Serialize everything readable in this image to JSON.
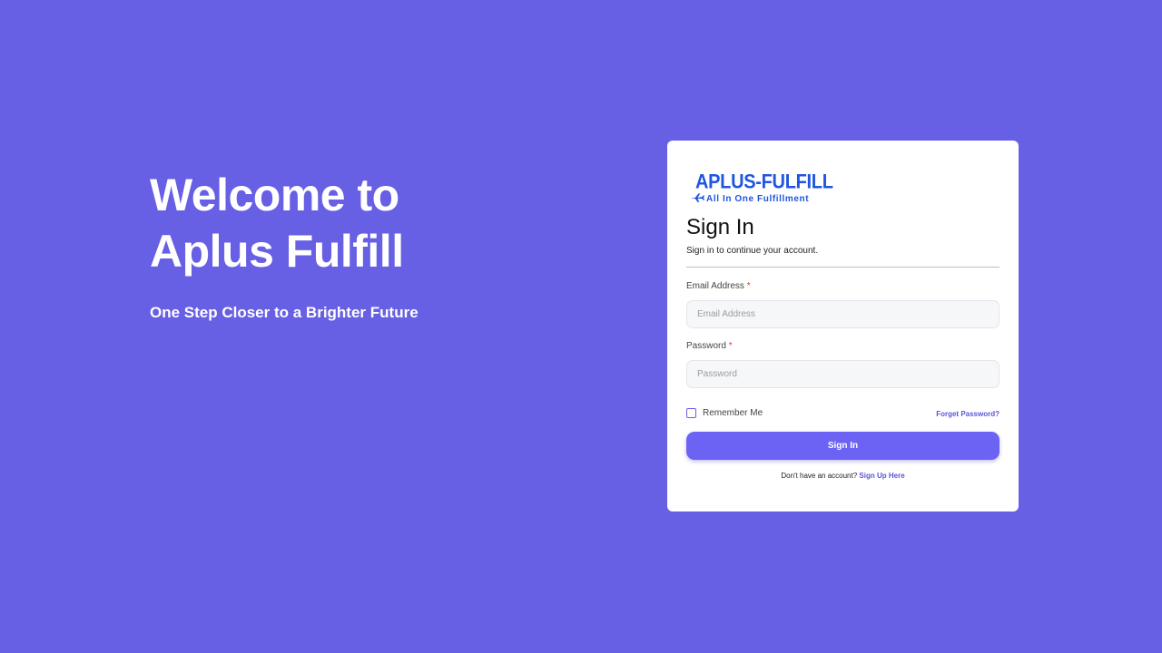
{
  "hero": {
    "title_line1": "Welcome to",
    "title_line2": "Aplus Fulfill",
    "subtitle": "One Step Closer to a Brighter Future"
  },
  "logo": {
    "wordmark": "APLUS-FULFILL",
    "tagline": "All  In One Fulfillment"
  },
  "signin": {
    "title": "Sign In",
    "subtitle": "Sign in to continue your account.",
    "email_label": "Email Address",
    "email_placeholder": "Email Address",
    "password_label": "Password",
    "password_placeholder": "Password",
    "required_mark": "*",
    "remember_label": "Remember Me",
    "forgot_label": "Forget Password?",
    "button_label": "Sign In",
    "signup_prompt": "Don't have an account?",
    "signup_link": "Sign Up Here"
  },
  "colors": {
    "background": "#675fe4",
    "button": "#6c63f5",
    "brand_blue": "#1f55e0",
    "link": "#5a55d6",
    "required": "#e3342f"
  }
}
